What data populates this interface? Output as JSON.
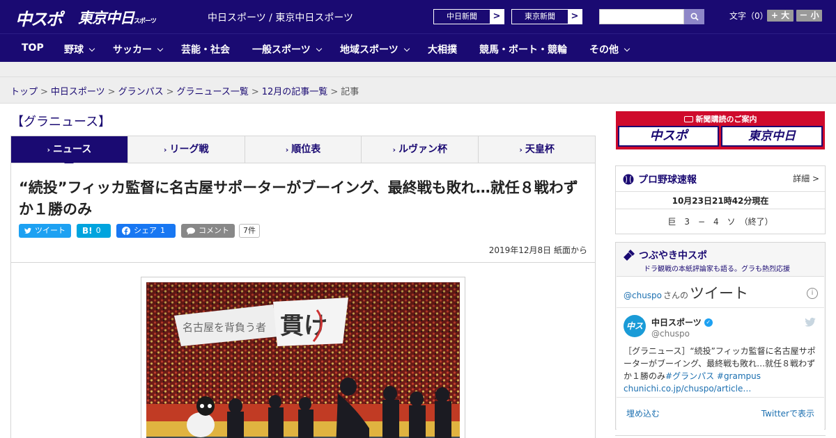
{
  "header": {
    "logo_chuspo": "中スポ",
    "logo_tokyo": "東京中日",
    "logo_tokyo_small": "スポーツ",
    "site_links": "中日スポーツ / 東京中日スポーツ",
    "paper_buttons": [
      "中日新聞",
      "東京新聞"
    ],
    "search_placeholder": "",
    "fontsize_label": "文字（0）",
    "fontsize_up": "+ 大",
    "fontsize_down": "－ 小"
  },
  "nav": {
    "items": [
      "TOP",
      "野球",
      "サッカー",
      "芸能・社会",
      "一般スポーツ",
      "地域スポーツ",
      "大相撲",
      "競馬・ボート・競輪",
      "その他"
    ]
  },
  "breadcrumb": {
    "items": [
      "トップ",
      "中日スポーツ",
      "グランパス",
      "グラニュース一覧",
      "12月の記事一覧"
    ],
    "current": "記事",
    "separator": ">"
  },
  "section_title": "【グラニュース】",
  "tabs": [
    "ニュース",
    "リーグ戦",
    "順位表",
    "ルヴァン杯",
    "天皇杯"
  ],
  "article": {
    "headline": "“続投”フィッカ監督に名古屋サポーターがブーイング、最終戦も敗れ…就任８戦わずか１勝のみ",
    "share": {
      "tweet": "ツイート",
      "hatena": "B!",
      "hatena_count": "0",
      "facebook": "シェア",
      "facebook_count": "1",
      "comment": "コメント",
      "comment_count": "7件"
    },
    "date": "2019年12月8日 紙面から",
    "photo_banner_text": "貫け",
    "photo_banner_text2": "名古屋を背負う者"
  },
  "sidebar": {
    "subscribe_title": "新聞購読のご案内",
    "subscribe_logos": [
      "中スポ",
      "東京中日"
    ],
    "baseball": {
      "title": "プロ野球速報",
      "detail": "詳細 >",
      "time": "10月23日21時42分現在",
      "score": "巨　3　−　4　ソ　（終了）"
    },
    "tweets": {
      "title": "つぶやき中スポ",
      "subtitle": "ドラ観戦の本紙評論家も語る。グラも熱烈応援",
      "handle_prefix": "@chuspo",
      "handle_suffix": "さんの",
      "header_big": "ツイート",
      "account_name": "中日スポーツ",
      "account_handle": "@chuspo",
      "avatar_text": "中スポ",
      "text_main": "［グラニュース］“続投”フィッカ監督に名古屋サポーターがブーイング、最終戦も敗れ…就任８戦わずか１勝のみ",
      "text_tags": "#グランパス #grampus",
      "text_link": "chunichi.co.jp/chuspo/article…",
      "embed": "埋め込む",
      "view": "Twitterで表示"
    }
  },
  "colors": {
    "brand_navy": "#1a0a72",
    "subscribe_red": "#cf0a2c",
    "twitter_blue": "#1da1f2",
    "facebook_blue": "#1877f2",
    "hatena_blue": "#00a4de"
  }
}
